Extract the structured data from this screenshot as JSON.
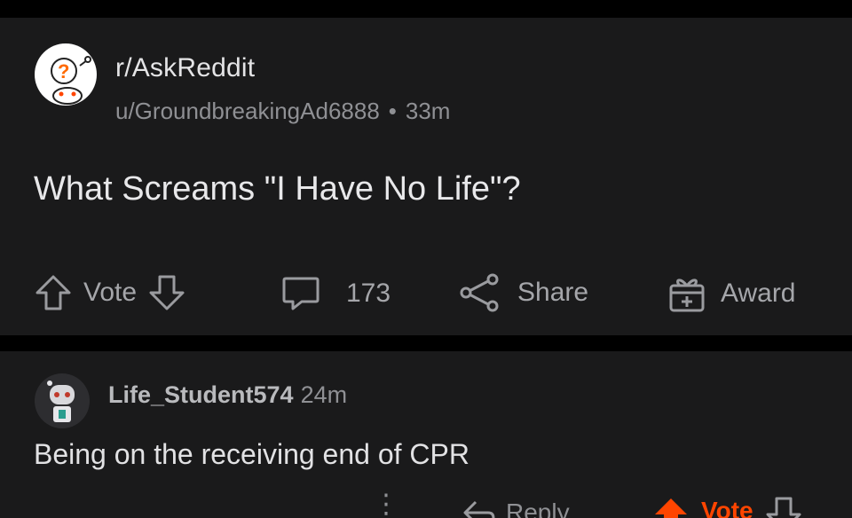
{
  "post": {
    "subreddit": "r/AskReddit",
    "author": "u/GroundbreakingAd6888",
    "separator": "•",
    "age": "33m",
    "title": "What Screams \"I Have No Life\"?",
    "actions": {
      "vote_label": "Vote",
      "comment_count": "173",
      "share_label": "Share",
      "award_label": "Award"
    }
  },
  "comment": {
    "author": "Life_Student574",
    "age": "24m",
    "body": "Being on the receiving end of CPR",
    "actions": {
      "more": "⋮",
      "reply_label": "Reply",
      "vote_label": "Vote"
    }
  },
  "colors": {
    "background": "#000000",
    "card": "#1a1a1b",
    "text_primary": "#e4e4e6",
    "text_secondary": "#8f9094",
    "upvote_active": "#ff4500"
  },
  "icons": [
    "askreddit-avatar-icon",
    "upvote-icon",
    "downvote-icon",
    "comment-icon",
    "share-icon",
    "award-icon",
    "user-avatar-icon",
    "reply-icon",
    "more-icon"
  ]
}
